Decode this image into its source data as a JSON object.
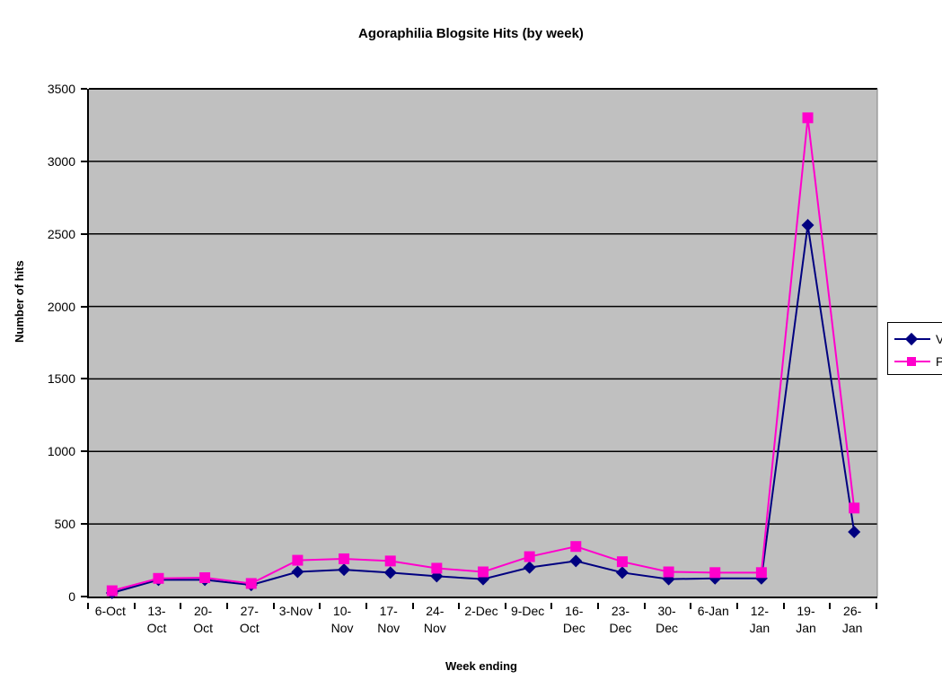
{
  "chart_data": {
    "type": "line",
    "title": "Agoraphilia Blogsite Hits (by week)",
    "xlabel": "Week ending",
    "ylabel": "Number of hits",
    "ylim": [
      0,
      3500
    ],
    "ytick_step": 500,
    "yticks": [
      "0",
      "500",
      "1000",
      "1500",
      "2000",
      "2500",
      "3000",
      "3500"
    ],
    "grid": "horizontal",
    "legend_position": "right",
    "plot_background": "#c0c0c0",
    "categories": [
      "6-Oct",
      "13-Oct",
      "20-Oct",
      "27-Oct",
      "3-Nov",
      "10-Nov",
      "17-Nov",
      "24-Nov",
      "2-Dec",
      "9-Dec",
      "16-Dec",
      "23-Dec",
      "30-Dec",
      "6-Jan",
      "12-Jan",
      "19-Jan",
      "26-Jan"
    ],
    "series": [
      {
        "name": "Visits",
        "label_clipped": "Vis",
        "color": "#000080",
        "marker": "diamond",
        "values": [
          25,
          115,
          115,
          80,
          170,
          185,
          165,
          140,
          120,
          200,
          245,
          165,
          120,
          125,
          125,
          2560,
          445
        ]
      },
      {
        "name": "Page views",
        "label_clipped": "Pa",
        "color": "#ff00cc",
        "marker": "square",
        "values": [
          40,
          125,
          130,
          90,
          250,
          260,
          245,
          195,
          170,
          275,
          345,
          240,
          170,
          165,
          165,
          3300,
          610
        ]
      }
    ]
  }
}
